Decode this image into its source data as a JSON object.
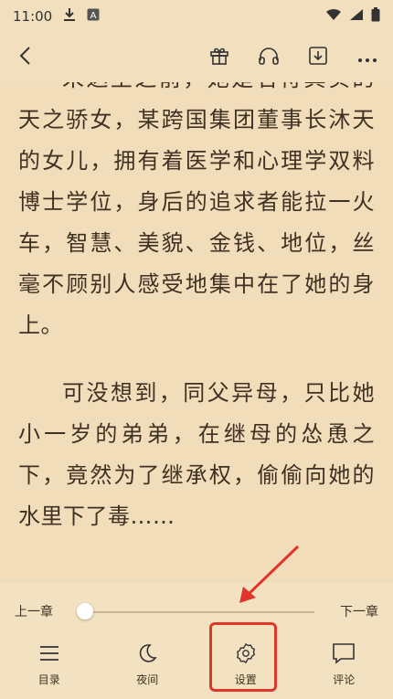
{
  "status": {
    "time": "11:00",
    "left_icons": [
      "download-icon",
      "app-icon"
    ],
    "right_icons": [
      "wifi-icon",
      "signal-icon",
      "battery-icon"
    ]
  },
  "topbar": {
    "back_icon": "chevron-left-icon",
    "actions": [
      "gift-icon",
      "headphones-icon",
      "download-icon",
      "more-icon"
    ]
  },
  "reader": {
    "paragraph1": "未达至之前，她是名符其实的天之骄女，某跨国集团董事长沐天的女儿，拥有着医学和心理学双料博士学位，身后的追求者能拉一火车，智慧、美貌、金钱、地位，丝毫不顾别人感受地集中在了她的身上。",
    "paragraph2": "可没想到，同父异母，只比她小一岁的弟弟，在继母的怂恿之下，竟然为了继承权，偷偷向她的水里下了毒……"
  },
  "progress": {
    "prev_label": "上一章",
    "next_label": "下一章",
    "value": 0.0
  },
  "menu": {
    "items": [
      {
        "label": "目录",
        "icon": "list-icon"
      },
      {
        "label": "夜间",
        "icon": "moon-icon"
      },
      {
        "label": "设置",
        "icon": "settings-icon"
      },
      {
        "label": "评论",
        "icon": "comment-icon"
      }
    ]
  },
  "colors": {
    "background": "#f2dfbd",
    "text": "#3f3123",
    "highlight": "#e2352a"
  }
}
